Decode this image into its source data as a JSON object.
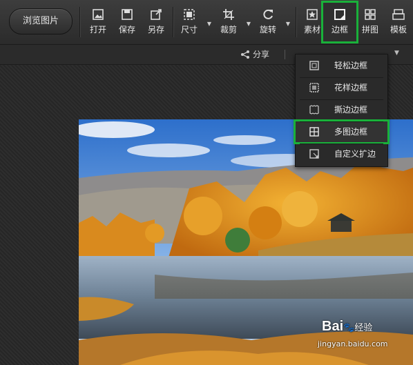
{
  "toolbar": {
    "browse_label": "浏览图片",
    "tools": [
      {
        "label": "打开",
        "icon": "open-image-icon"
      },
      {
        "label": "保存",
        "icon": "save-icon"
      },
      {
        "label": "另存",
        "icon": "save-as-icon"
      },
      {
        "label": "尺寸",
        "icon": "resize-icon"
      },
      {
        "label": "裁剪",
        "icon": "crop-icon"
      },
      {
        "label": "旋转",
        "icon": "rotate-icon"
      },
      {
        "label": "素材",
        "icon": "material-icon"
      },
      {
        "label": "边框",
        "icon": "border-icon"
      },
      {
        "label": "拼图",
        "icon": "collage-icon"
      },
      {
        "label": "模板",
        "icon": "template-icon"
      }
    ],
    "highlight_color": "#19b13a"
  },
  "subbar": {
    "share_label": "分享"
  },
  "border_menu": {
    "items": [
      {
        "label": "轻松边框",
        "icon": "simple-border-icon"
      },
      {
        "label": "花样边框",
        "icon": "pattern-border-icon"
      },
      {
        "label": "撕边边框",
        "icon": "torn-edge-border-icon"
      },
      {
        "label": "多图边框",
        "icon": "multi-image-border-icon"
      },
      {
        "label": "自定义扩边",
        "icon": "custom-extend-icon"
      }
    ],
    "highlighted": "多图边框"
  },
  "watermark": {
    "brand": "Bai",
    "suffix": "经验",
    "url": "jingyan.baidu.com"
  }
}
